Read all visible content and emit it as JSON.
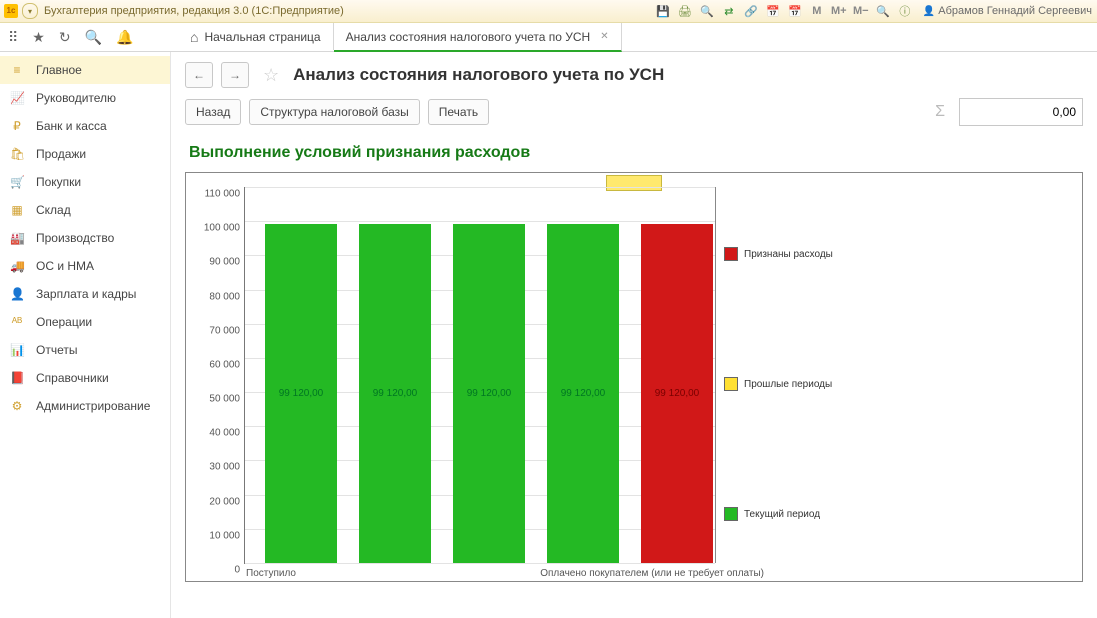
{
  "titlebar": {
    "app_title": "Бухгалтерия предприятия, редакция 3.0  (1С:Предприятие)",
    "user": "Абрамов Геннадий Сергеевич",
    "mtext_m": "M",
    "mtext_mp": "M+",
    "mtext_mm": "M−"
  },
  "tabs": {
    "home": "Начальная страница",
    "active": "Анализ состояния налогового учета по УСН"
  },
  "sidebar": [
    {
      "icon": "≡",
      "label": "Главное"
    },
    {
      "icon": "📈",
      "label": "Руководителю"
    },
    {
      "icon": "₽",
      "label": "Банк и касса"
    },
    {
      "icon": "🛍",
      "label": "Продажи"
    },
    {
      "icon": "🛒",
      "label": "Покупки"
    },
    {
      "icon": "▦",
      "label": "Склад"
    },
    {
      "icon": "🏭",
      "label": "Производство"
    },
    {
      "icon": "🚚",
      "label": "ОС и НМА"
    },
    {
      "icon": "👤",
      "label": "Зарплата и кадры"
    },
    {
      "icon": "ᴬᴮ",
      "label": "Операции"
    },
    {
      "icon": "📊",
      "label": "Отчеты"
    },
    {
      "icon": "📕",
      "label": "Справочники"
    },
    {
      "icon": "⚙",
      "label": "Администрирование"
    }
  ],
  "page": {
    "title": "Анализ состояния налогового учета по УСН",
    "btn_back": "Назад",
    "btn_struct": "Структура налоговой базы",
    "btn_print": "Печать",
    "sum_value": "0,00",
    "section": "Выполнение условий признания расходов"
  },
  "chart_data": {
    "type": "bar",
    "title": "Выполнение условий признания расходов",
    "ylabel": "",
    "ylim": [
      0,
      110000
    ],
    "ytick_step": 10000,
    "categories": [
      "Поступило",
      "",
      "",
      "",
      "Оплачено покупателем (или не требует оплаты)"
    ],
    "series": [
      {
        "name": "Текущий период",
        "color": "#24b924",
        "values": [
          99120,
          99120,
          99120,
          99120,
          null
        ]
      },
      {
        "name": "Признаны расходы",
        "color": "#d11818",
        "values": [
          null,
          null,
          null,
          null,
          99120
        ]
      },
      {
        "name": "Прошлые периоды",
        "color": "#ffe033",
        "values": [
          null,
          null,
          null,
          null,
          null
        ]
      }
    ],
    "bar_label": "99 120,00",
    "xlabels": {
      "left": "Поступило",
      "right": "Оплачено покупателем (или не требует оплаты)"
    }
  },
  "legend": {
    "l1": "Признаны расходы",
    "l2": "Прошлые периоды",
    "l3": "Текущий период"
  }
}
